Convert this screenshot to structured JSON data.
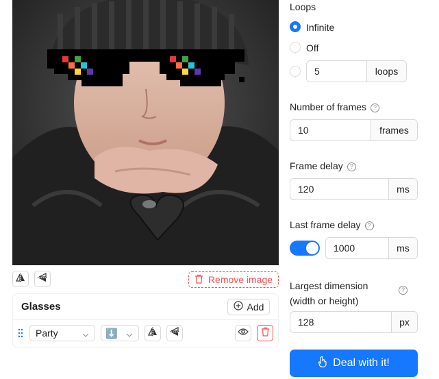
{
  "image": {
    "remove_label": "Remove image",
    "flip_h_icon": "flip-horizontal-icon",
    "flip_v_icon": "flip-vertical-icon"
  },
  "glasses": {
    "title": "Glasses",
    "add_label": "Add",
    "items": [
      {
        "style": "Party",
        "direction": "⬇️",
        "visible": true
      }
    ]
  },
  "settings": {
    "loops": {
      "label": "Loops",
      "options": [
        "Infinite",
        "Off"
      ],
      "selected": "Infinite",
      "custom_value": "5",
      "custom_unit": "loops"
    },
    "frames": {
      "label": "Number of frames",
      "value": "10",
      "unit": "frames"
    },
    "frame_delay": {
      "label": "Frame delay",
      "value": "120",
      "unit": "ms"
    },
    "last_frame_delay": {
      "label": "Last frame delay",
      "enabled": true,
      "value": "1000",
      "unit": "ms"
    },
    "largest_dimension": {
      "label_line1": "Largest dimension",
      "label_line2": "(width or height)",
      "value": "128",
      "unit": "px"
    }
  },
  "action": {
    "label": "Deal with it!"
  },
  "colors": {
    "accent": "#1677ff",
    "danger": "#ff4d4f",
    "border": "#d9d9d9"
  }
}
